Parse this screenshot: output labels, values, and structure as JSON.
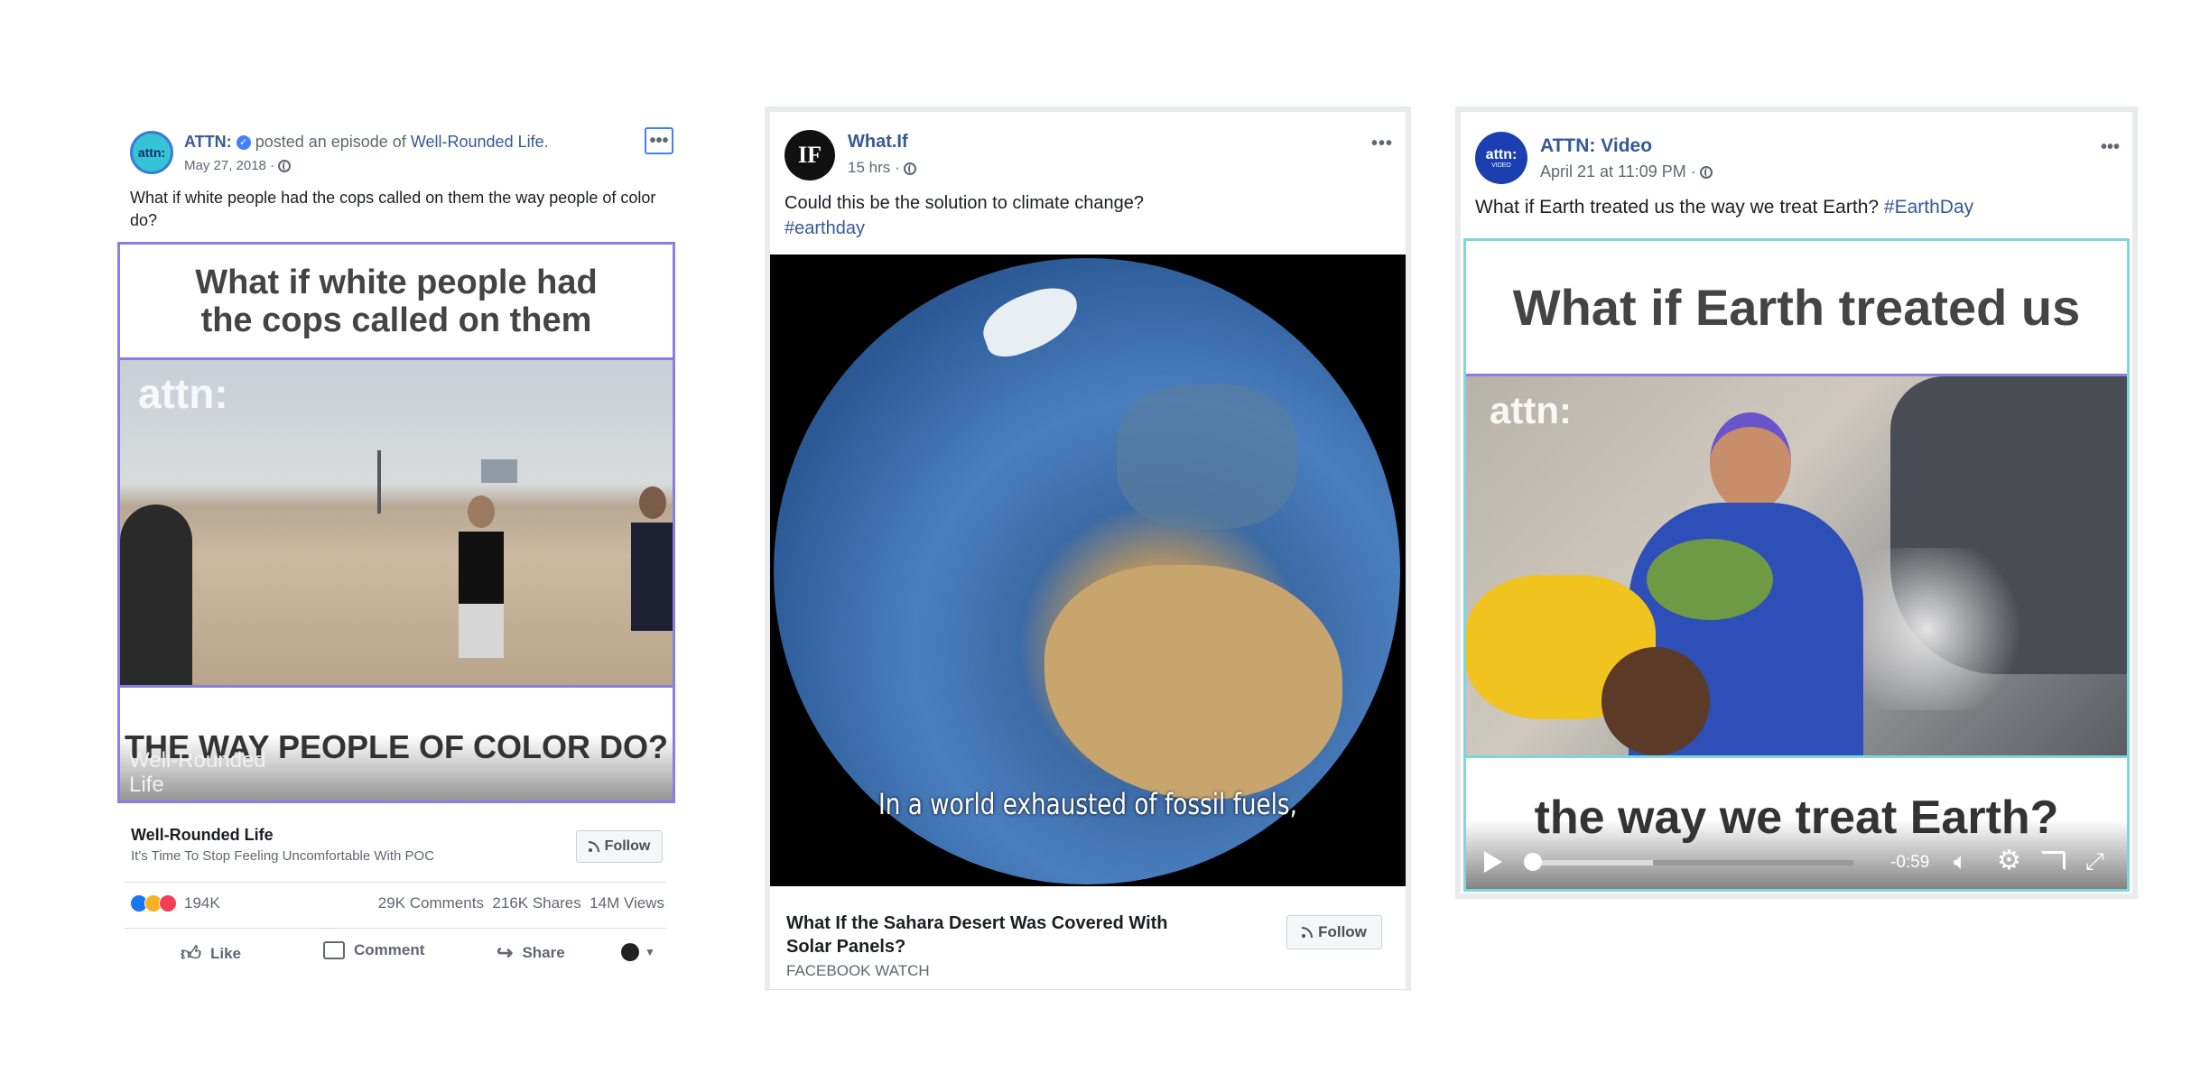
{
  "post1": {
    "page_name": "ATTN:",
    "posted_text": "posted an episode of",
    "show_link": "Well-Rounded Life",
    "date": "May 27, 2018 ·",
    "text": "What if white people had the cops called on them the way people of color do?",
    "video_top_caption": "What if white people had the cops called on them",
    "watermark": "attn:",
    "video_bottom_caption": "THE WAY PEOPLE OF COLOR DO?",
    "corner_watermark": "Well-Rounded Life",
    "show_title": "Well-Rounded Life",
    "show_tagline": "It's Time To Stop Feeling Uncomfortable With POC",
    "follow_label": "Follow",
    "reactions_count": "194K",
    "comments_count": "29K Comments",
    "shares_count": "216K Shares",
    "views_count": "14M Views",
    "like_label": "Like",
    "comment_label": "Comment",
    "share_label": "Share",
    "avatar_text": "attn:"
  },
  "post2": {
    "page_name": "What.If",
    "avatar_text": "IF",
    "time": "15 hrs ·",
    "text": "Could this be the solution to climate change?",
    "hashtag": "#earthday",
    "subtitle": "In a world exhausted of fossil fuels,",
    "video_title": "What If the Sahara Desert Was Covered With Solar Panels?",
    "source": "FACEBOOK WATCH",
    "follow_label": "Follow"
  },
  "post3": {
    "page_name": "ATTN: Video",
    "avatar_text": "attn:",
    "avatar_subtext": "VIDEO",
    "time": "April 21 at 11:09 PM ·",
    "text": "What if Earth treated us the way we treat Earth?",
    "hashtag": "#EarthDay",
    "video_top_caption": "What if Earth treated us",
    "watermark": "attn:",
    "video_bottom_caption": "the way we treat Earth?",
    "time_remaining": "-0:59",
    "progress_fraction": 0.38
  },
  "colors": {
    "link": "#385898",
    "caption_border": "#8a7fe0",
    "meta": "#606770"
  }
}
